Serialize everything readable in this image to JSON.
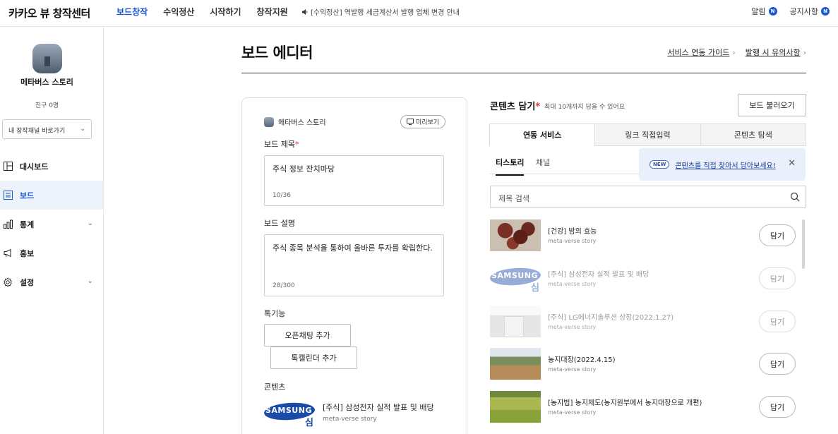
{
  "brand": "카카오 뷰 창작센터",
  "nav": {
    "items": [
      "보드창작",
      "수익정산",
      "시작하기",
      "창작지원"
    ],
    "active_index": 0,
    "notice": "[수익정산] 역발행 세금계산서 발행 업체 변경 안내"
  },
  "top_right": {
    "alarm": "알림",
    "alarm_badge": "N",
    "notice": "공지사항",
    "notice_badge": "N"
  },
  "sidebar": {
    "profile_name": "메타버스 스토리",
    "friends": "친구 0명",
    "channel_select": "내 창작채널 바로가기",
    "items": [
      {
        "label": "대시보드",
        "icon": "dashboard-icon",
        "expandable": false,
        "active": false
      },
      {
        "label": "보드",
        "icon": "board-icon",
        "expandable": false,
        "active": true
      },
      {
        "label": "통계",
        "icon": "chart-icon",
        "expandable": true,
        "active": false
      },
      {
        "label": "홍보",
        "icon": "megaphone-icon",
        "expandable": false,
        "active": false
      },
      {
        "label": "설정",
        "icon": "gear-icon",
        "expandable": true,
        "active": false
      }
    ]
  },
  "header": {
    "title": "보드 에디터",
    "guide1": "서비스 연동 가이드",
    "guide2": "발행 시 유의사항"
  },
  "editor": {
    "owner": "메타버스 스토리",
    "preview": "미리보기",
    "title_label": "보드 제목",
    "title_value": "주식 정보 잔치마당",
    "title_count": "10/36",
    "desc_label": "보드 설명",
    "desc_value": "주식 종목 분석을 통하여 올바른 투자를 확립한다.",
    "desc_count": "28/300",
    "func_label": "톡기능",
    "open_chat_btn": "오픈채팅 추가",
    "calendar_btn": "톡캘린더 추가",
    "content_label": "콘텐츠",
    "content_item": {
      "title": "[주식] 삼성전자 실적 발표 및 배당",
      "source": "meta-verse story",
      "thumb_word": "SAMSUNG",
      "thumb_hangul": "심"
    }
  },
  "content_panel": {
    "title": "콘텐츠 담기",
    "hint": "최대 10개까지 담을 수 있어요",
    "load_btn": "보드 불러오기",
    "tabs": [
      "연동 서비스",
      "링크 직접입력",
      "콘텐츠 탐색"
    ],
    "subtabs": [
      "티스토리",
      "채널"
    ],
    "tip_badge": "NEW",
    "tip_text": "콘텐츠를 직접 찾아서 담아보세요!",
    "search_placeholder": "제목 검색",
    "add_label": "담기",
    "items": [
      {
        "title": "[건강] 밤의 효능",
        "source": "meta-verse story",
        "dim": false
      },
      {
        "title": "[주식] 삼성전자 실적 발표 및 배당",
        "source": "meta-verse story",
        "dim": true
      },
      {
        "title": "[주식] LG에너지솔루션 상장(2022.1.27)",
        "source": "meta-verse story",
        "dim": true
      },
      {
        "title": "농지대장(2022.4.15)",
        "source": "meta-verse story",
        "dim": false
      },
      {
        "title": "[농지법] 농지제도(농지원부에서 농지대장으로 개편)",
        "source": "meta-verse story",
        "dim": false
      }
    ]
  },
  "colors": {
    "accent": "#1a56d6",
    "required": "#e03333",
    "tip_bg": "#e9f0fb"
  }
}
